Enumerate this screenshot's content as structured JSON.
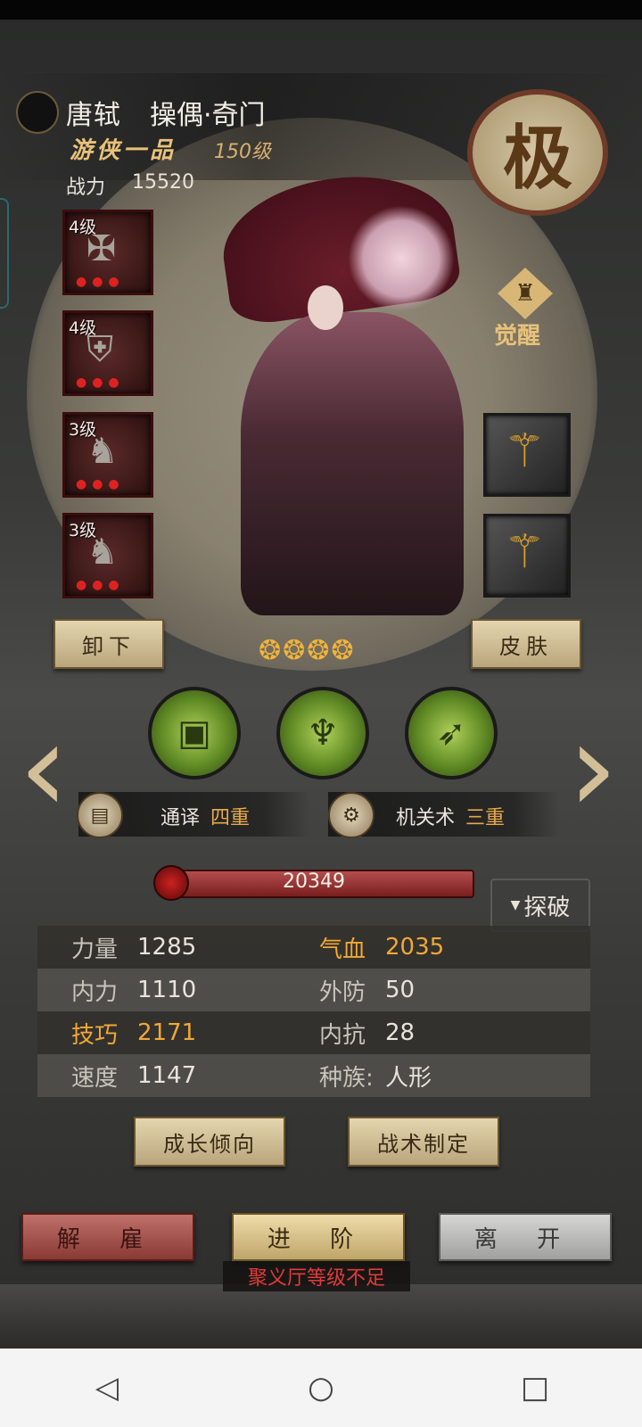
{
  "character": {
    "name": "唐轼",
    "class": "操偶·奇门",
    "rank": "游侠一品",
    "level": "150级",
    "power_label": "战力",
    "power_value": "15520",
    "grade_seal": "极",
    "awaken_label": "觉醒"
  },
  "equipment": [
    {
      "level": "4级",
      "icon": "crossbow-icon"
    },
    {
      "level": "4级",
      "icon": "armor-icon"
    },
    {
      "level": "3级",
      "icon": "wooden-horse-icon"
    },
    {
      "level": "3级",
      "icon": "wooden-horse-icon"
    }
  ],
  "weapons": [
    {
      "icon": "gold-pole-weapon-icon"
    },
    {
      "icon": "gold-pole-weapon-icon"
    }
  ],
  "actions": {
    "unequip": "卸下",
    "skin": "皮肤"
  },
  "stars": 4,
  "skills": [
    {
      "icon": "puppet-box-skill-icon"
    },
    {
      "icon": "puppet-summon-skill-icon"
    },
    {
      "icon": "spear-thrust-skill-icon"
    }
  ],
  "passives": [
    {
      "name": "通译",
      "tier": "四重",
      "icon": "scroll-icon"
    },
    {
      "name": "机关术",
      "tier": "三重",
      "icon": "gear-icon"
    }
  ],
  "hp": {
    "value": "20349"
  },
  "explore_label": "探破",
  "stats": [
    {
      "l_name": "力量",
      "l_val": "1285",
      "r_name": "气血",
      "r_val": "2035",
      "l_hl": false,
      "r_hl": true
    },
    {
      "l_name": "内力",
      "l_val": "1110",
      "r_name": "外防",
      "r_val": "50",
      "l_hl": false,
      "r_hl": false
    },
    {
      "l_name": "技巧",
      "l_val": "2171",
      "r_name": "内抗",
      "r_val": "28",
      "l_hl": true,
      "r_hl": false
    },
    {
      "l_name": "速度",
      "l_val": "1147",
      "r_name": "种族:",
      "r_val": "人形",
      "l_hl": false,
      "r_hl": false
    }
  ],
  "mid_buttons": {
    "growth": "成长倾向",
    "tactics": "战术制定"
  },
  "bottom_buttons": {
    "dismiss": "解 雇",
    "advance": "进 阶",
    "leave": "离 开"
  },
  "warning": "聚义厅等级不足",
  "colors": {
    "accent_gold": "#e8a84a",
    "warning_red": "#e23a3a",
    "hp_red": "#7a1e1e"
  }
}
